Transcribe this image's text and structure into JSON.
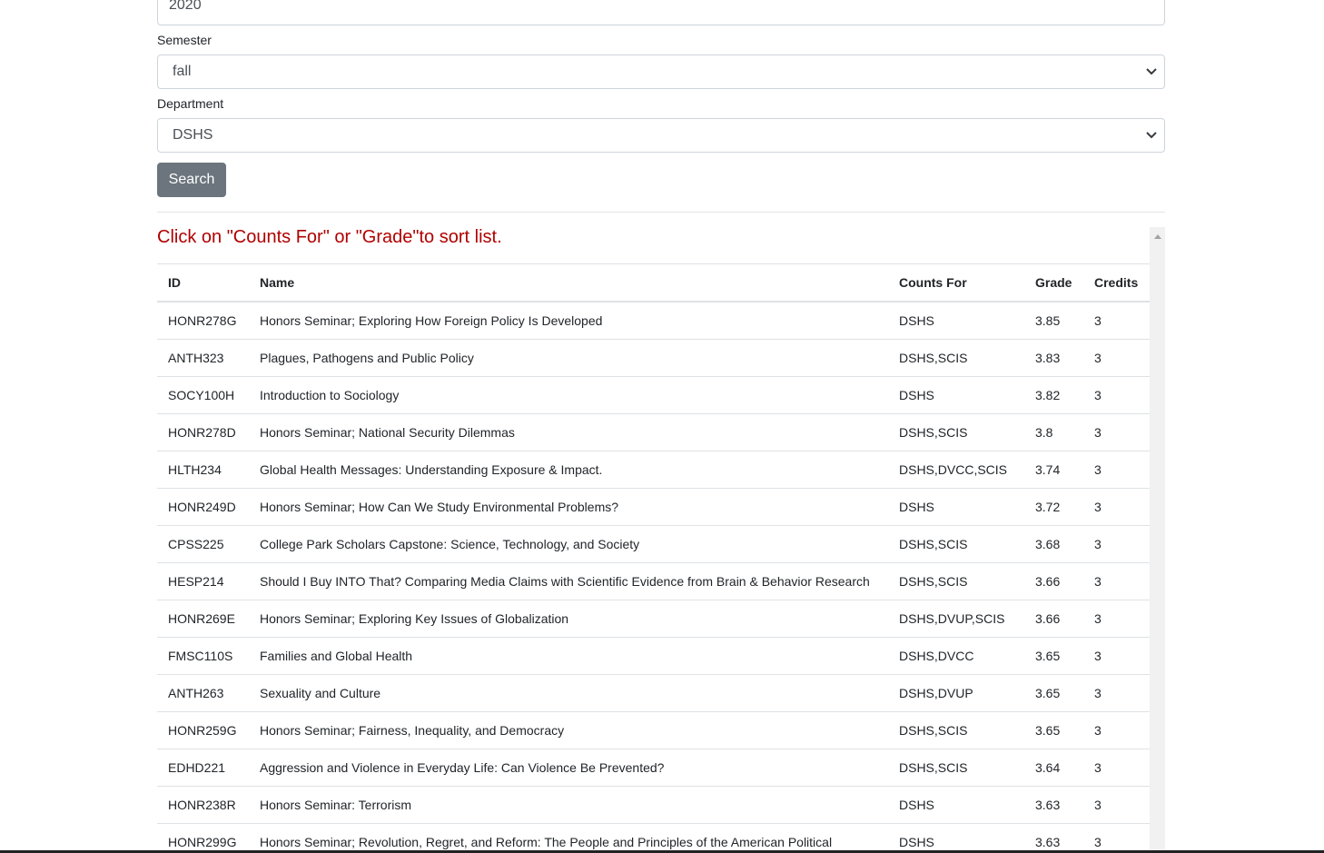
{
  "form": {
    "year_value": "2020",
    "semester_label": "Semester",
    "semester_value": "fall",
    "department_label": "Department",
    "department_value": "DSHS",
    "search_label": "Search"
  },
  "hint": "Click on \"Counts For\" or \"Grade\"to sort list.",
  "table": {
    "headers": {
      "id": "ID",
      "name": "Name",
      "counts_for": "Counts For",
      "grade": "Grade",
      "credits": "Credits"
    },
    "rows": [
      {
        "id": "HONR278G",
        "name": "Honors Seminar; Exploring How Foreign Policy Is Developed",
        "counts_for": "DSHS",
        "grade": "3.85",
        "credits": "3"
      },
      {
        "id": "ANTH323",
        "name": "Plagues, Pathogens and Public Policy",
        "counts_for": "DSHS,SCIS",
        "grade": "3.83",
        "credits": "3"
      },
      {
        "id": "SOCY100H",
        "name": "Introduction to Sociology",
        "counts_for": "DSHS",
        "grade": "3.82",
        "credits": "3"
      },
      {
        "id": "HONR278D",
        "name": "Honors Seminar; National Security Dilemmas",
        "counts_for": "DSHS,SCIS",
        "grade": "3.8",
        "credits": "3"
      },
      {
        "id": "HLTH234",
        "name": "Global Health Messages: Understanding Exposure & Impact.",
        "counts_for": "DSHS,DVCC,SCIS",
        "grade": "3.74",
        "credits": "3"
      },
      {
        "id": "HONR249D",
        "name": "Honors Seminar; How Can We Study Environmental Problems?",
        "counts_for": "DSHS",
        "grade": "3.72",
        "credits": "3"
      },
      {
        "id": "CPSS225",
        "name": "College Park Scholars Capstone: Science, Technology, and Society",
        "counts_for": "DSHS,SCIS",
        "grade": "3.68",
        "credits": "3"
      },
      {
        "id": "HESP214",
        "name": "Should I Buy INTO That? Comparing Media Claims with Scientific Evidence from Brain & Behavior Research",
        "counts_for": "DSHS,SCIS",
        "grade": "3.66",
        "credits": "3"
      },
      {
        "id": "HONR269E",
        "name": "Honors Seminar; Exploring Key Issues of Globalization",
        "counts_for": "DSHS,DVUP,SCIS",
        "grade": "3.66",
        "credits": "3"
      },
      {
        "id": "FMSC110S",
        "name": "Families and Global Health",
        "counts_for": "DSHS,DVCC",
        "grade": "3.65",
        "credits": "3"
      },
      {
        "id": "ANTH263",
        "name": "Sexuality and Culture",
        "counts_for": "DSHS,DVUP",
        "grade": "3.65",
        "credits": "3"
      },
      {
        "id": "HONR259G",
        "name": "Honors Seminar; Fairness, Inequality, and Democracy",
        "counts_for": "DSHS,SCIS",
        "grade": "3.65",
        "credits": "3"
      },
      {
        "id": "EDHD221",
        "name": "Aggression and Violence in Everyday Life: Can Violence Be Prevented?",
        "counts_for": "DSHS,SCIS",
        "grade": "3.64",
        "credits": "3"
      },
      {
        "id": "HONR238R",
        "name": "Honors Seminar: Terrorism",
        "counts_for": "DSHS",
        "grade": "3.63",
        "credits": "3"
      },
      {
        "id": "HONR299G",
        "name": "Honors Seminar; Revolution, Regret, and Reform: The People and Principles of the American Political",
        "counts_for": "DSHS",
        "grade": "3.63",
        "credits": "3"
      }
    ]
  },
  "icons": {
    "select_chevron": "chevron-down-icon",
    "scroll_up": "triangle-up-icon"
  },
  "colors": {
    "hint": "#b00000",
    "button": "#6c757d"
  }
}
